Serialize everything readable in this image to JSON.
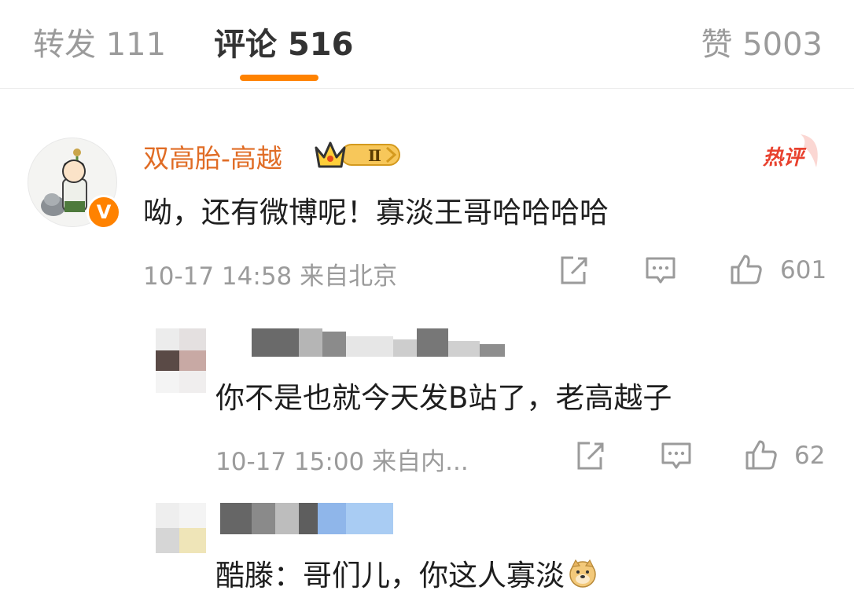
{
  "tabs": {
    "repost": {
      "label": "转发",
      "count": "111"
    },
    "comments": {
      "label": "评论",
      "count": "516"
    },
    "likes": {
      "label": "赞",
      "count": "5003"
    }
  },
  "main_comment": {
    "username": "双高胎-高越",
    "vip_level": "Ⅱ",
    "verified_badge": "V",
    "hot_tag": "热评",
    "text": "呦，还有微博呢！寡淡王哥哈哈哈哈",
    "time": "10-17 14:58",
    "location": "来自北京",
    "like_count": "601"
  },
  "replies": [
    {
      "text": "你不是也就今天发B站了，老高越子",
      "time": "10-17 15:00",
      "location": "来自内...",
      "like_count": "62"
    },
    {
      "text": "酷滕：哥们儿，你这人寡淡",
      "emoji": "doge-emoji"
    }
  ],
  "icons": [
    "share-icon",
    "comment-icon",
    "like-icon",
    "crown-icon",
    "doge-emoji"
  ],
  "colors": {
    "accent": "#ff8200",
    "username": "#e06c25",
    "hot": "#e8412e",
    "meta": "#9b9b9b"
  }
}
